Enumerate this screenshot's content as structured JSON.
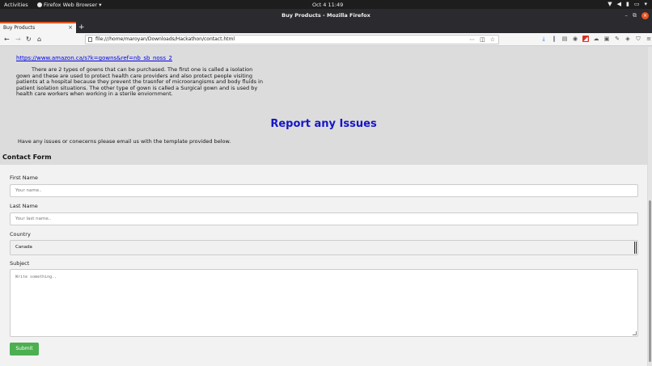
{
  "topbar": {
    "activities": "Activities",
    "app_name": "Firefox Web Browser",
    "app_caret": "▾",
    "clock": "Oct 4  11:49",
    "tray_icons": [
      "network-icon",
      "volume-icon",
      "mic-icon",
      "battery-icon",
      "menu-caret-icon"
    ]
  },
  "window": {
    "title": "Buy Products - Mozilla Firefox",
    "minimize": "–",
    "maximize": "⧉",
    "close": "×"
  },
  "tab": {
    "label": "Buy Products",
    "close": "×",
    "new_tab": "+"
  },
  "nav": {
    "back": "←",
    "forward": "→",
    "reload": "↻",
    "home": "⌂",
    "url": "file:///home/maroyan/Downloads/Hackathon/contact.html",
    "url_menu": "⋯",
    "pocket": "◫",
    "bookmark_star": "☆",
    "menu": "≡"
  },
  "page": {
    "amazon_link": "https://www.amazon.ca/s?k=gowns&ref=nb_sb_noss_2",
    "gown_paragraph": "There are 2 types of gowns that can be purchased. The first one is called a isolation gown and these are used to protect health care providers and also protect people visiting patients at a hospital because they prevent the trasnfer of microorangisms and body fluids in patient isolation situations. The other type of gown is called a Surgical gown and is used by health care workers when working in a sterile enviornment.",
    "report_heading": "Report any Issues",
    "issues_text": "Have any issues or conecerns please email us with the template provided below.",
    "contact_title": "Contact Form"
  },
  "form": {
    "first_name_label": "First Name",
    "first_name_placeholder": "Your name..",
    "last_name_label": "Last Name",
    "last_name_placeholder": "Your last name..",
    "country_label": "Country",
    "country_value": "Canada",
    "subject_label": "Subject",
    "subject_placeholder": "Write something..",
    "submit_label": "Submit"
  },
  "colors": {
    "heading": "#1515c8",
    "link": "#0000ee",
    "submit": "#4caf50",
    "ubuntu_accent": "#e95420"
  }
}
